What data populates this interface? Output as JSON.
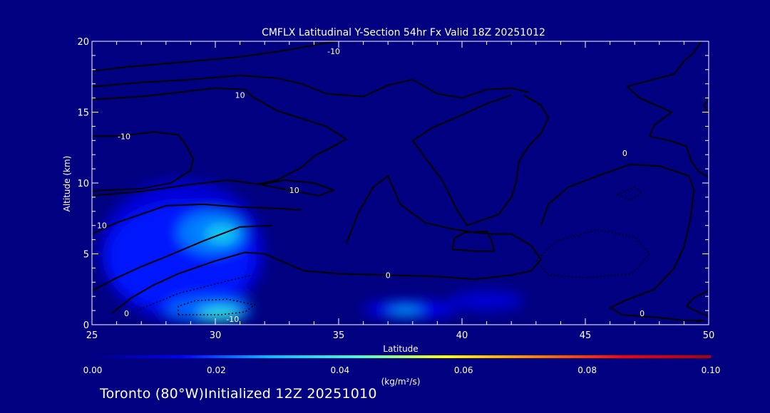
{
  "colors": {
    "background": "#000080",
    "contour_line": "#000000",
    "text": "#ffffff",
    "colorbar_stops": [
      "#000080",
      "#0000ff",
      "#00bfff",
      "#40ffd0",
      "#ffff00",
      "#ff8000",
      "#ff0000",
      "#b00000"
    ]
  },
  "chart_data": {
    "type": "heatmap",
    "title": "CMFLX Latitudinal Y-Section 54hr  Fx Valid 18Z 20251012",
    "xlabel": "Latitude",
    "ylabel": "Altitude (km)",
    "xlim": [
      25,
      50
    ],
    "ylim": [
      0,
      20
    ],
    "x_ticks": [
      25,
      30,
      35,
      40,
      45,
      50
    ],
    "x_tick_labels": [
      "25",
      "30",
      "35",
      "40",
      "45",
      "50"
    ],
    "y_ticks": [
      0,
      5,
      10,
      15,
      20
    ],
    "y_tick_labels": [
      "0",
      "5",
      "10",
      "15",
      "20"
    ],
    "colorbar": {
      "range": [
        0.0,
        0.1
      ],
      "tick_labels": [
        "0.00",
        "0.02",
        "0.04",
        "0.06",
        "0.08",
        "0.10"
      ],
      "units": "(kg/m²/s)"
    },
    "flux_regions": [
      {
        "x": [
          25.3,
          32.0
        ],
        "y": [
          0.2,
          10.2
        ],
        "value": 0.01
      },
      {
        "x": [
          25.6,
          31.5
        ],
        "y": [
          1.0,
          8.6
        ],
        "value": 0.016
      },
      {
        "x": [
          28.5,
          31.2
        ],
        "y": [
          5.0,
          8.0
        ],
        "value": 0.024
      },
      {
        "x": [
          29.6,
          30.9
        ],
        "y": [
          5.8,
          7.0
        ],
        "value": 0.034
      },
      {
        "x": [
          28.0,
          31.5
        ],
        "y": [
          0.2,
          2.0
        ],
        "value": 0.022
      },
      {
        "x": [
          29.3,
          31.1
        ],
        "y": [
          0.3,
          1.2
        ],
        "value": 0.04
      },
      {
        "x": [
          36.0,
          39.8
        ],
        "y": [
          0.5,
          1.7
        ],
        "value": 0.014
      },
      {
        "x": [
          37.0,
          38.4
        ],
        "y": [
          0.8,
          1.2
        ],
        "value": 0.032
      },
      {
        "x": [
          39.5,
          42.5
        ],
        "y": [
          1.0,
          2.4
        ],
        "value": 0.01
      }
    ],
    "contours": [
      {
        "level": -10,
        "label": "-10",
        "points": [
          [
            25,
            17.9
          ],
          [
            26.5,
            18.2
          ],
          [
            28.5,
            18.5
          ],
          [
            31,
            18.9
          ],
          [
            33,
            19.4
          ],
          [
            34.5,
            19.9
          ],
          [
            35,
            20
          ]
        ]
      },
      {
        "level": 10,
        "label": "10",
        "points": [
          [
            25,
            16.8
          ],
          [
            27,
            17.1
          ],
          [
            29,
            17.3
          ],
          [
            31,
            17.6
          ],
          [
            32.5,
            17.4
          ],
          [
            33.5,
            17.0
          ],
          [
            34.5,
            16.3
          ],
          [
            36,
            16.1
          ],
          [
            37,
            16.9
          ],
          [
            38,
            17.3
          ],
          [
            39,
            16.3
          ],
          [
            40,
            16.0
          ],
          [
            41,
            16.6
          ],
          [
            42,
            16.7
          ],
          [
            42.7,
            16.4
          ]
        ]
      },
      {
        "level": -10,
        "label": "-10",
        "points": [
          [
            25,
            15.9
          ],
          [
            27,
            16.1
          ],
          [
            30,
            16.7
          ],
          [
            31.2,
            16.6
          ],
          [
            31.5,
            16.1
          ],
          [
            32.5,
            15.1
          ],
          [
            34.5,
            14.0
          ],
          [
            35.3,
            13.1
          ],
          [
            34.8,
            12.6
          ],
          [
            34,
            11.9
          ],
          [
            33.5,
            11.1
          ],
          [
            32.5,
            10.2
          ],
          [
            31.7,
            9.9
          ]
        ]
      },
      {
        "level": -10,
        "label": "-10",
        "points": [
          [
            25,
            13.3
          ],
          [
            26,
            13.3
          ],
          [
            27.5,
            13.6
          ],
          [
            28.5,
            13.4
          ],
          [
            28.8,
            12.7
          ],
          [
            29.1,
            11.7
          ],
          [
            29,
            10.9
          ],
          [
            28.2,
            10.0
          ],
          [
            27,
            9.6
          ],
          [
            25.5,
            9.5
          ],
          [
            25,
            9.4
          ]
        ]
      },
      {
        "level": 0,
        "label": "0",
        "points": [
          [
            25,
            9.1
          ],
          [
            27,
            9.4
          ],
          [
            29,
            9.9
          ],
          [
            30.5,
            10.2
          ],
          [
            31.8,
            9.9
          ],
          [
            32.8,
            10.2
          ],
          [
            34,
            10.0
          ],
          [
            34.8,
            9.5
          ],
          [
            34.2,
            9.1
          ],
          [
            33,
            9.5
          ],
          [
            31.8,
            9.9
          ]
        ]
      },
      {
        "level": 10,
        "label": "10",
        "points": [
          [
            25,
            6.4
          ],
          [
            26,
            7.2
          ],
          [
            27,
            7.8
          ],
          [
            28,
            8.4
          ],
          [
            29.5,
            8.5
          ],
          [
            31,
            8.3
          ],
          [
            32.5,
            8.2
          ],
          [
            33.5,
            8.1
          ]
        ]
      },
      {
        "level": 0,
        "label": "0",
        "points": [
          [
            25,
            2.4
          ],
          [
            26,
            3.3
          ],
          [
            27,
            4.1
          ],
          [
            28,
            4.8
          ],
          [
            29.5,
            5.9
          ],
          [
            31,
            6.9
          ],
          [
            32.3,
            7.0
          ]
        ]
      },
      {
        "level": 0,
        "label": "0",
        "points": [
          [
            25.8,
            0.8
          ],
          [
            26.6,
            1.9
          ],
          [
            27.5,
            2.8
          ],
          [
            28.5,
            3.6
          ],
          [
            30,
            4.5
          ],
          [
            31.2,
            5.1
          ],
          [
            32,
            5.0
          ],
          [
            32.8,
            4.4
          ],
          [
            33.6,
            3.8
          ],
          [
            35,
            3.6
          ],
          [
            37,
            3.5
          ],
          [
            39,
            3.4
          ],
          [
            40.5,
            3.2
          ],
          [
            42,
            3.5
          ],
          [
            42.8,
            3.8
          ],
          [
            43.2,
            4.6
          ],
          [
            42.8,
            5.6
          ],
          [
            42,
            6.4
          ],
          [
            41.3,
            6.4
          ],
          [
            40.5,
            6.5
          ],
          [
            39.5,
            6.8
          ],
          [
            38.5,
            7.2
          ],
          [
            37.5,
            8.5
          ],
          [
            37,
            10.5
          ],
          [
            36.4,
            9.7
          ],
          [
            35.8,
            7.9
          ],
          [
            35.3,
            5.7
          ]
        ]
      },
      {
        "level": 0,
        "label": "0",
        "points": [
          [
            42.5,
            16.2
          ],
          [
            43.2,
            15.5
          ],
          [
            43.5,
            14.6
          ],
          [
            43.2,
            13.5
          ],
          [
            42.7,
            12.6
          ],
          [
            42.3,
            11.5
          ],
          [
            42.2,
            10.1
          ],
          [
            42,
            9.0
          ],
          [
            41.5,
            7.8
          ],
          [
            40.2,
            7.0
          ],
          [
            39.8,
            8.1
          ],
          [
            39.2,
            10.2
          ],
          [
            38.5,
            11.8
          ],
          [
            38,
            13.0
          ],
          [
            38.8,
            13.9
          ],
          [
            40,
            14.8
          ],
          [
            41,
            15.6
          ],
          [
            42,
            16.2
          ]
        ]
      },
      {
        "level": 0,
        "label": "0",
        "points": [
          [
            39.6,
            5.3
          ],
          [
            40.5,
            5.2
          ],
          [
            41.3,
            5.2
          ],
          [
            41.2,
            5.9
          ],
          [
            41,
            6.6
          ],
          [
            40.1,
            6.5
          ],
          [
            39.7,
            6.1
          ],
          [
            39.6,
            5.3
          ]
        ]
      },
      {
        "level": 0,
        "label": "0",
        "points": [
          [
            43.2,
            7.0
          ],
          [
            43.5,
            8.5
          ],
          [
            44.3,
            9.7
          ],
          [
            45.5,
            10.5
          ],
          [
            46.8,
            11.3
          ],
          [
            48,
            11.2
          ],
          [
            49.2,
            10.5
          ],
          [
            49.4,
            9.5
          ],
          [
            49.3,
            8.0
          ],
          [
            49.2,
            7.0
          ],
          [
            49.0,
            5.5
          ],
          [
            48.6,
            4.0
          ],
          [
            47.8,
            2.5
          ],
          [
            46.6,
            1.7
          ],
          [
            46,
            1.2
          ],
          [
            46.5,
            0.7
          ],
          [
            48,
            0.5
          ],
          [
            49,
            0.3
          ],
          [
            49.8,
            0.3
          ],
          [
            49.5,
            0.2
          ]
        ]
      },
      {
        "level": 0,
        "label": "0",
        "points": [
          [
            50,
            2.4
          ],
          [
            49.4,
            1.9
          ],
          [
            49.1,
            1.3
          ],
          [
            49.7,
            0.8
          ],
          [
            50,
            0.6
          ]
        ]
      },
      {
        "level": 0,
        "label": "0",
        "points": [
          [
            49.7,
            20
          ],
          [
            49.4,
            19.2
          ],
          [
            49,
            18.6
          ],
          [
            48.6,
            17.7
          ],
          [
            47.3,
            17.1
          ],
          [
            46.7,
            16.8
          ],
          [
            47.2,
            16.0
          ],
          [
            48.5,
            15.0
          ],
          [
            47.8,
            14.1
          ],
          [
            47.6,
            13.3
          ],
          [
            48.4,
            13.0
          ],
          [
            49.1,
            12.6
          ],
          [
            49.3,
            11.5
          ],
          [
            49.6,
            10.8
          ],
          [
            50,
            10.4
          ]
        ]
      },
      {
        "level": 0,
        "label": "0",
        "points": [
          [
            50,
            15.9
          ],
          [
            49.8,
            15.5
          ],
          [
            49.9,
            15.2
          ],
          [
            50,
            15.0
          ]
        ]
      }
    ],
    "dotted_contours": [
      {
        "points": [
          [
            43.0,
            4.5
          ],
          [
            43.8,
            5.9
          ],
          [
            45.5,
            6.7
          ],
          [
            47,
            6.2
          ],
          [
            47.6,
            5.0
          ],
          [
            46.9,
            3.6
          ],
          [
            45,
            3.3
          ],
          [
            43.5,
            3.5
          ],
          [
            43.0,
            4.5
          ]
        ]
      },
      {
        "points": [
          [
            46.3,
            9.2
          ],
          [
            47.0,
            9.7
          ],
          [
            47.3,
            9.3
          ],
          [
            46.8,
            8.8
          ],
          [
            46.3,
            9.2
          ]
        ]
      },
      {
        "points": [
          [
            28.5,
            0.7
          ],
          [
            30.2,
            0.7
          ],
          [
            31.2,
            0.9
          ],
          [
            31.6,
            1.4
          ],
          [
            30.5,
            1.8
          ],
          [
            29.2,
            1.7
          ],
          [
            28.5,
            1.3
          ],
          [
            28.5,
            0.7
          ]
        ]
      },
      {
        "points": [
          [
            26.8,
            1.0
          ],
          [
            28.5,
            2.2
          ],
          [
            30.5,
            3.1
          ],
          [
            31.5,
            3.5
          ]
        ]
      }
    ],
    "contour_labels": [
      {
        "text": "-10",
        "x": 34.8,
        "y": 19.3
      },
      {
        "text": "10",
        "x": 31.0,
        "y": 16.2
      },
      {
        "text": "-10",
        "x": 26.3,
        "y": 13.3
      },
      {
        "text": "10",
        "x": 33.2,
        "y": 9.5
      },
      {
        "text": "10",
        "x": 25.4,
        "y": 7.0
      },
      {
        "text": "0",
        "x": 26.4,
        "y": 0.8
      },
      {
        "text": "-10",
        "x": 30.7,
        "y": 0.4
      },
      {
        "text": "0",
        "x": 37.0,
        "y": 3.5
      },
      {
        "text": "0",
        "x": 46.6,
        "y": 12.1
      },
      {
        "text": "0",
        "x": 47.3,
        "y": 0.8
      }
    ]
  },
  "footer": {
    "location": "Toronto (80°W)",
    "initialized": "Initialized 12Z 20251010"
  }
}
